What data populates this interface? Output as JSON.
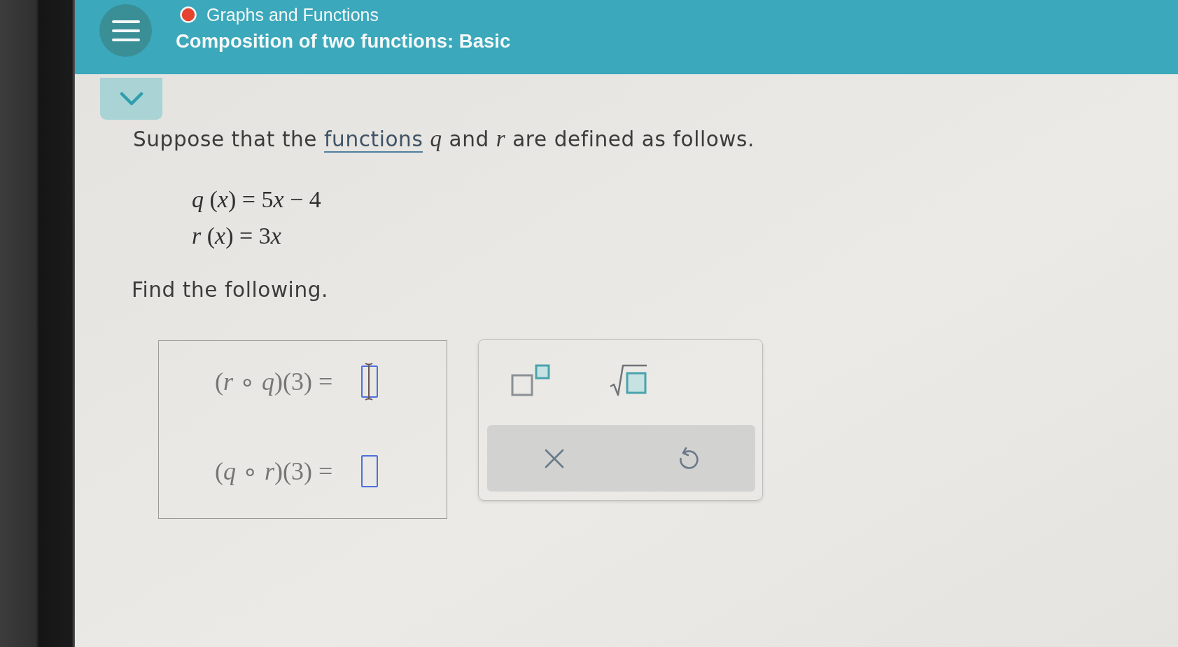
{
  "header": {
    "topic": "Graphs and Functions",
    "title": "Composition of two functions: Basic"
  },
  "problem": {
    "intro": {
      "before": "Suppose that the",
      "link": "functions",
      "after": "*q* and *r* are defined as follows."
    },
    "definitions": [
      "q (x) = 5x − 4",
      "r (x) = 3x"
    ],
    "prompt": "Find the following."
  },
  "answers": [
    {
      "expression": "(*r* ∘ *q*)(3) =",
      "focused": true
    },
    {
      "expression": "(*q* ∘ *r*)(3) =",
      "focused": false
    }
  ]
}
